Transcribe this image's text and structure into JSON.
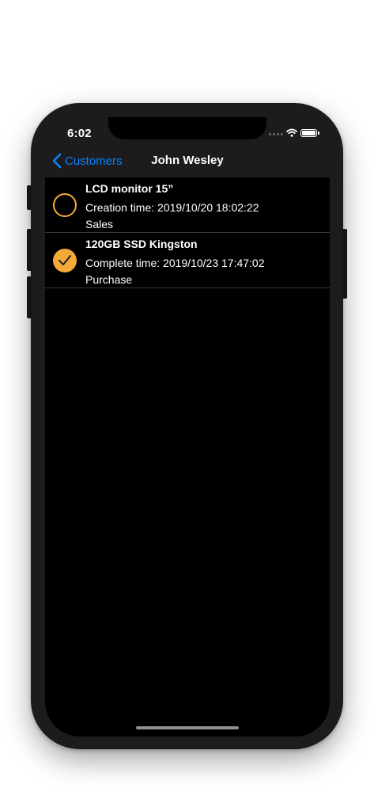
{
  "status_bar": {
    "time": "6:02",
    "icons": [
      "cellular-signal-icon",
      "wifi-icon",
      "battery-icon"
    ]
  },
  "nav": {
    "back_label": "Customers",
    "back_icon": "chevron-left-icon",
    "title": "John Wesley"
  },
  "orders": [
    {
      "title": "LCD monitor 15”",
      "subtitle": "Creation time: 2019/10/20 18:02:22",
      "type": "Sales",
      "completed": false
    },
    {
      "title": "120GB SSD Kingston",
      "subtitle": "Complete time: 2019/10/23 17:47:02",
      "type": "Purchase",
      "completed": true
    }
  ],
  "colors": {
    "accent": "#0a84ff",
    "check": "#f5a93a",
    "background": "#000000",
    "nav_bar": "#1c1c1e",
    "separator": "#38383a"
  }
}
